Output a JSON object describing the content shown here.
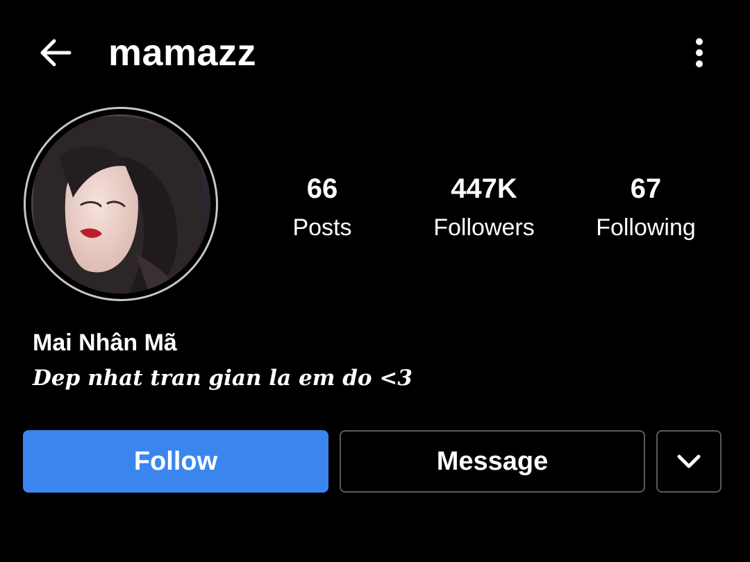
{
  "colors": {
    "background": "#000000",
    "text": "#ffffff",
    "follow_button": "#3a86ee",
    "button_border": "#5a5a5a",
    "avatar_ring": "#c7c7c7"
  },
  "header": {
    "username": "mamazz",
    "back_icon": "arrow-left-icon",
    "more_icon": "vertical-dots-icon"
  },
  "profile": {
    "avatar_icon": "profile-photo",
    "stats": [
      {
        "value": "66",
        "label": "Posts"
      },
      {
        "value": "447K",
        "label": "Followers"
      },
      {
        "value": "67",
        "label": "Following"
      }
    ],
    "display_name": "Mai Nhân Mã",
    "bio": "Dep nhat tran gian la em do <3"
  },
  "actions": {
    "follow_label": "Follow",
    "message_label": "Message",
    "dropdown_icon": "chevron-down-icon"
  }
}
